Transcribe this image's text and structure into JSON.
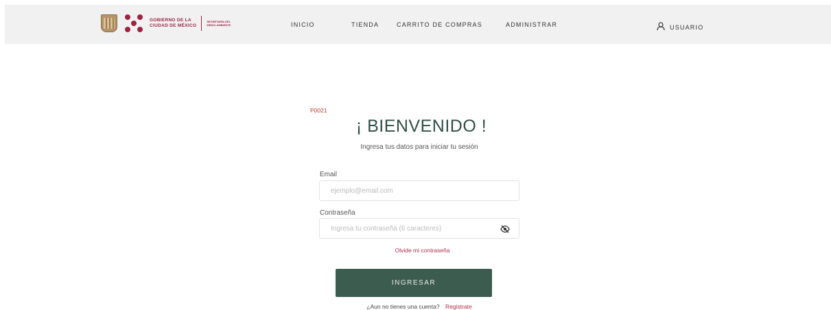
{
  "header": {
    "logo": {
      "gov_line1": "GOBIERNO DE LA",
      "gov_line2": "CIUDAD DE MÉXICO",
      "secretaria_line1": "SECRETARÍA DEL",
      "secretaria_line2": "MEDIO AMBIENTE",
      "brand_color": "#9f2241"
    },
    "nav": {
      "inicio": "INICIO",
      "tienda": "TIENDA",
      "carrito": "CARRITO DE COMPRAS",
      "administrar": "ADMINISTRAR"
    },
    "user": {
      "label": "USUARIO",
      "icon": "user-icon"
    }
  },
  "login": {
    "code": "P0021",
    "title": "¡ BIENVENIDO !",
    "subtitle": "Ingresa tus datos para iniciar tu sesión",
    "email": {
      "label": "Email",
      "value": "",
      "placeholder": "ejemplo@email.com"
    },
    "password": {
      "label": "Contraseña",
      "value": "",
      "placeholder": "Ingresa tu contraseña (6 caracteres)",
      "toggle_icon": "eye-slash-icon"
    },
    "forgot": "Olvide mi contraseña",
    "submit": "INGRESAR",
    "no_account": "¿Aun no tienes una cuenta?",
    "register": "Registrate"
  },
  "colors": {
    "primary": "#3d5c50",
    "accent": "#b02a4a",
    "code_red": "#c0392b",
    "navbar_bg": "#f1f1f1"
  }
}
